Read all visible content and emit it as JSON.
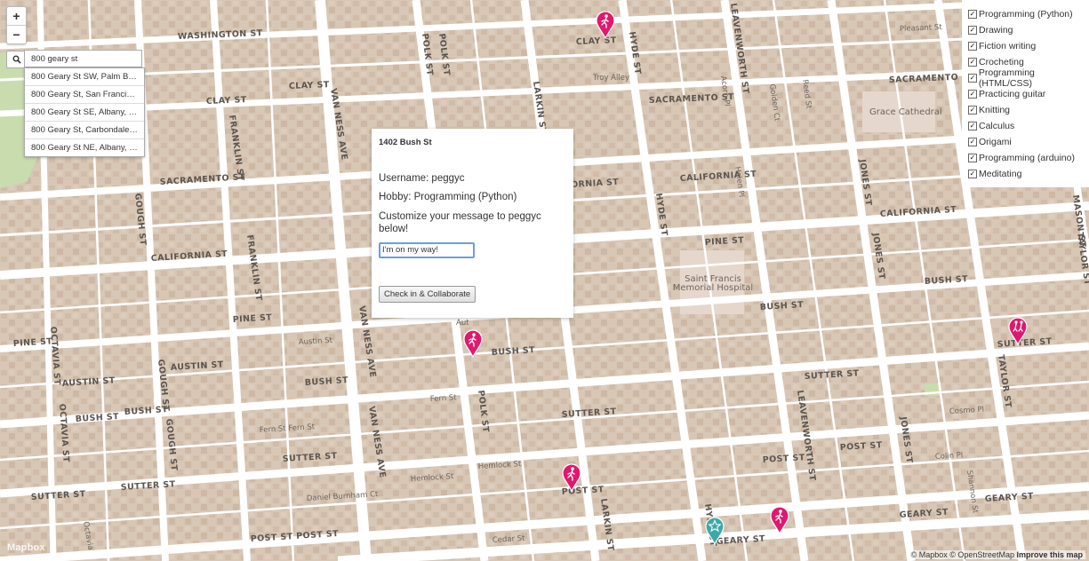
{
  "map": {
    "streets": {
      "washington": "WASHINGTON ST",
      "clay": "CLAY ST",
      "sacramento": "SACRAMENTO ST",
      "california": "CALIFORNIA ST",
      "pine": "PINE ST",
      "bush": "BUSH ST",
      "sutter": "SUTTER ST",
      "post": "POST ST",
      "geary": "GEARY ST",
      "franklin": "FRANKLIN ST",
      "van_ness": "VAN NESS AVE",
      "polk": "POLK ST",
      "larkin": "LARKIN ST",
      "hyde": "HYDE ST",
      "leavenworth": "LEAVENWORTH ST",
      "jones": "JONES ST",
      "taylor": "TAYLOR ST",
      "mason": "MASON ST",
      "gough": "GOUGH ST",
      "octavia": "OCTAVIA ST",
      "austin": "AUSTIN ST",
      "post_st_post": "POST ST POST ST",
      "sutter_sutter": "SUTTER ST"
    },
    "small": {
      "troy_alley": "Troy Alley",
      "pleasant": "Pleasant St",
      "golden_ct": "Golden Ct",
      "reed": "Reed St",
      "acorn": "Acorn Pl",
      "helen": "Helen Pl",
      "austin": "Austin St",
      "fern": "Fern St",
      "fern2": "Fern St Fern St",
      "hemlock": "Hemlock St",
      "hemlock2": "Hemlock St",
      "daniel_burnham": "Daniel Burnham Ct",
      "cedar": "Cedar St",
      "cosmo": "Cosmo Pl",
      "colin": "Colin Pl",
      "shannon": "Shannon St",
      "octavia_small": "Octavia",
      "auto": "Aut"
    },
    "pois": {
      "grace": "Grace Cathedral",
      "saint_francis": "Saint Francis\nMemorial Hospital"
    }
  },
  "zoom": {
    "in": "+",
    "out": "−"
  },
  "search": {
    "query": "800 geary st",
    "results": [
      "800 Geary St SW, Palm Bay, Florida",
      "800 Geary St, San Francisco, California",
      "800 Geary St SE, Albany, Oregon",
      "800 Geary St, Carbondale, Illinois",
      "800 Geary St NE, Albany, Oregon"
    ]
  },
  "popup": {
    "address": "1402 Bush St",
    "username": "Username: peggyc",
    "hobby": "Hobby: Programming (Python)",
    "message_prompt": "Customize your message to peggyc below!",
    "message_value": "I'm on my way!",
    "button": "Check in & Collaborate"
  },
  "filters": [
    "Programming (Python)",
    "Drawing",
    "Fiction writing",
    "Crocheting",
    "Programming (HTML/CSS)",
    "Practicing guitar",
    "Knitting",
    "Calculus",
    "Origami",
    "Programming (arduino)",
    "Meditating"
  ],
  "attribution": {
    "mapbox": "© Mapbox",
    "osm": "© OpenStreetMap",
    "improve": "Improve this map"
  },
  "logo": "Mapbox",
  "colors": {
    "marker": "#e0186e",
    "home_marker": "#3ba9a8",
    "park": "#c9dcae",
    "road": "#ffffff",
    "block": "#d9c6b3"
  }
}
